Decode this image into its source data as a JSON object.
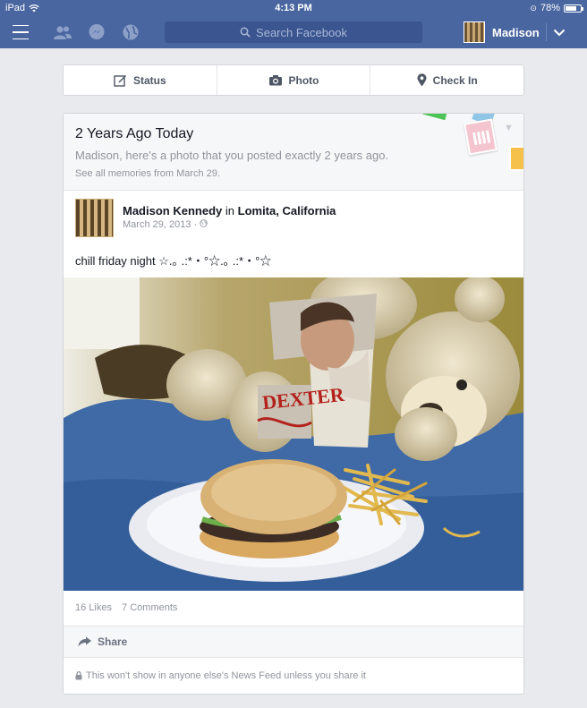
{
  "status_bar": {
    "device": "iPad",
    "time": "4:13 PM",
    "battery": "78%",
    "battery_level": 0.78
  },
  "nav": {
    "search_placeholder": "Search Facebook",
    "user_name": "Madison"
  },
  "composer": {
    "status_label": "Status",
    "photo_label": "Photo",
    "checkin_label": "Check In"
  },
  "memory": {
    "title": "2 Years Ago Today",
    "subtitle": "Madison, here's a photo that you posted exactly 2 years ago.",
    "link": "See all memories from March 29."
  },
  "post": {
    "author": "Madison Kennedy",
    "connector": "in",
    "location": "Lomita, California",
    "date": "March 29, 2013",
    "separator": "·",
    "text": "chill friday night ☆.｡ .:*・°☆.｡ .:*・°☆",
    "likes": "16 Likes",
    "comments": "7 Comments",
    "share_label": "Share",
    "privacy_note": "This won't show in anyone else's News Feed unless you share it"
  },
  "icons": {
    "menu": "hamburger-icon",
    "friends": "friends-icon",
    "messages": "messages-icon",
    "notifications": "globe-icon",
    "search": "search-icon",
    "status": "edit-icon",
    "photo": "camera-icon",
    "checkin": "location-pin-icon",
    "share": "share-arrow-icon",
    "privacy": "lock-icon",
    "audience": "globe-icon"
  },
  "colors": {
    "nav_blue": "#4a66a0",
    "background": "#e9eaed"
  }
}
